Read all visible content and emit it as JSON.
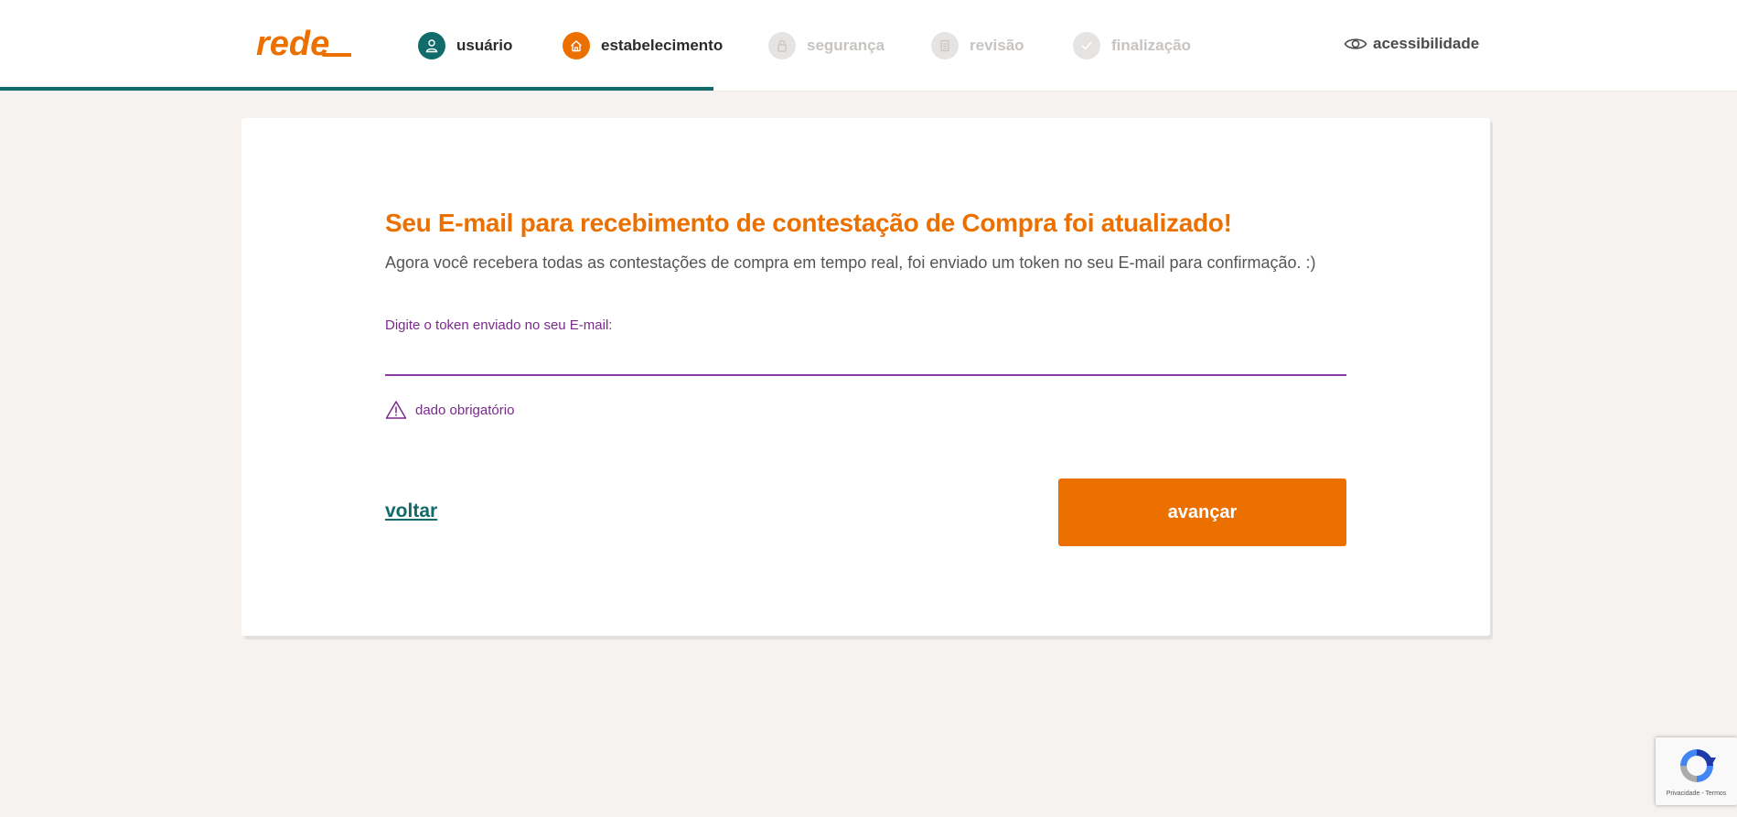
{
  "header": {
    "logo_text": "rede",
    "steps": [
      {
        "label": "usuário",
        "state": "done",
        "icon": "user-icon"
      },
      {
        "label": "estabelecimento",
        "state": "current",
        "icon": "home-icon"
      },
      {
        "label": "segurança",
        "state": "pending",
        "icon": "lock-icon"
      },
      {
        "label": "revisão",
        "state": "pending",
        "icon": "document-icon"
      },
      {
        "label": "finalização",
        "state": "pending",
        "icon": "check-icon"
      }
    ],
    "accessibility_label": "acessibilidade",
    "progress_fraction": 0.411
  },
  "main": {
    "title": "Seu E-mail para recebimento de contestação de Compra foi atualizado!",
    "subtitle": "Agora você recebera todas as contestações de compra em tempo real, foi enviado um token no seu E-mail para confirmação. :)",
    "token_field": {
      "label": "Digite o token enviado no seu E-mail:",
      "value": "",
      "placeholder": ""
    },
    "error_message": "dado obrigatório",
    "back_label": "voltar",
    "next_label": "avançar"
  },
  "recaptcha": {
    "links": "Privacidade - Termos"
  },
  "colors": {
    "brand_orange": "#ec7000",
    "teal": "#116b6b",
    "purple": "#7a2a8c",
    "background": "#f5f2ef"
  }
}
